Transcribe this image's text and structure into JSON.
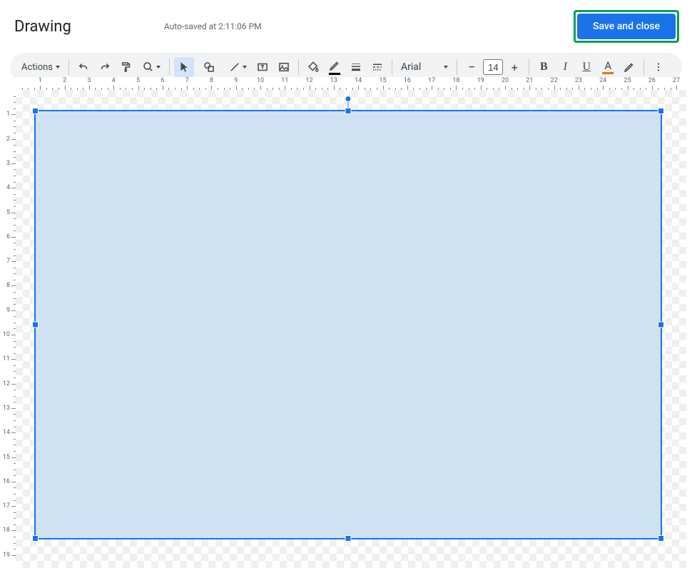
{
  "header": {
    "title": "Drawing",
    "autosave": "Auto-saved at 2:11:06 PM",
    "save_button": "Save and close"
  },
  "toolbar": {
    "actions_label": "Actions",
    "font_name": "Arial",
    "font_size": "14",
    "bold": "B",
    "italic": "I",
    "underline": "U",
    "text_color": "A",
    "decrease": "−",
    "increase": "+"
  },
  "ruler": {
    "h_labels": [
      1,
      2,
      3,
      4,
      5,
      6,
      7,
      8,
      9,
      10,
      11,
      12,
      13,
      14,
      15,
      16,
      17,
      18,
      19,
      20,
      21,
      22,
      23,
      24,
      25,
      26,
      27
    ],
    "v_labels": [
      1,
      2,
      3,
      4,
      5,
      6,
      7,
      8,
      9,
      10,
      11,
      12,
      13,
      14,
      15,
      16,
      17,
      18,
      19
    ]
  },
  "shape": {
    "fill_color": "#cfe2f3",
    "border_color": "#1a73e8"
  }
}
